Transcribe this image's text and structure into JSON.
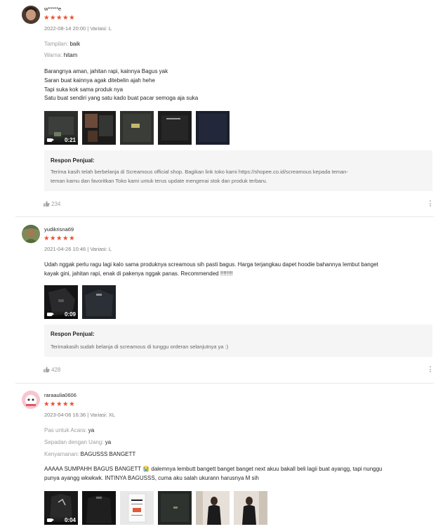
{
  "colors": {
    "accent": "#ee4d2d",
    "seller_bg": "#f5f5f5"
  },
  "reviews": [
    {
      "username": "w*****e",
      "stars": "★★★★★",
      "meta": "2022-08-14 20:00 | Variasi: L",
      "attributes": [
        {
          "key": "Tampilan:",
          "value": "baik"
        },
        {
          "key": "Warna:",
          "value": "hitam"
        }
      ],
      "body_lines": [
        "Barangnya aman, jahitan rapi, kainnya Bagus yak",
        "Saran buat kainnya agak ditebelin ajah hehe",
        "Tapi suka kok sama produk nya",
        "Satu buat sendiri yang satu kado buat pacar semoga aja suka"
      ],
      "media": [
        {
          "type": "video",
          "duration": "0:21"
        },
        {
          "type": "image"
        },
        {
          "type": "image"
        },
        {
          "type": "image"
        },
        {
          "type": "image"
        }
      ],
      "seller_title": "Respon Penjual:",
      "seller_lines": [
        "Terima kasih telah berbelanja di Screamous official shop. Bagikan link toko kami https://shopee.co.id/screamous kepada teman-",
        "teman kamu dan favoritkan Toko kami untuk terus update mengenai stok dan produk terbaru."
      ],
      "likes": "234"
    },
    {
      "username": "yudikrisna69",
      "stars": "★★★★★",
      "meta": "2021-04-26 10:46 | Variasi: L",
      "body_lines": [
        "Udah nggak perlu ragu lagi kalo sama produknya screamous sih pasti bagus. Harga terjangkau dapet hoodie bahannya lembut banget",
        "kayak gini, jahitan rapi, enak di pakenya nggak panas. Recommended !!!!!!!!"
      ],
      "media": [
        {
          "type": "video",
          "duration": "0:09"
        },
        {
          "type": "image"
        }
      ],
      "seller_title": "Respon Penjual:",
      "seller_lines": [
        "Terimakasih sudah belanja di screamous di tunggu orderan selanjutnya ya :)"
      ],
      "likes": "428"
    },
    {
      "username": "raraaulia0606",
      "stars": "★★★★★",
      "meta": "2023-04-06 16:36 | Variasi: XL",
      "attributes": [
        {
          "key": "Pas untuk Acara:",
          "value": "ya"
        },
        {
          "key": "Sepadan dengan Uang:",
          "value": "ya"
        },
        {
          "key": "Kenyamanan:",
          "value": "BAGUSSS BANGETT"
        }
      ],
      "body_lines": [
        "AAAAA SUMPAHH BAGUS BANGETT 😭 dalemnya lembutt bangett banget banget next akuu bakall beli lagii buat ayangg, tapi nunggu",
        "punya ayangg wkwkwk. INTINYA BAGUSSS, cuma aku salah ukurann harusnya M sih"
      ],
      "media": [
        {
          "type": "video",
          "duration": "0:04"
        },
        {
          "type": "image"
        },
        {
          "type": "image"
        },
        {
          "type": "image"
        },
        {
          "type": "image"
        },
        {
          "type": "image"
        }
      ]
    }
  ]
}
